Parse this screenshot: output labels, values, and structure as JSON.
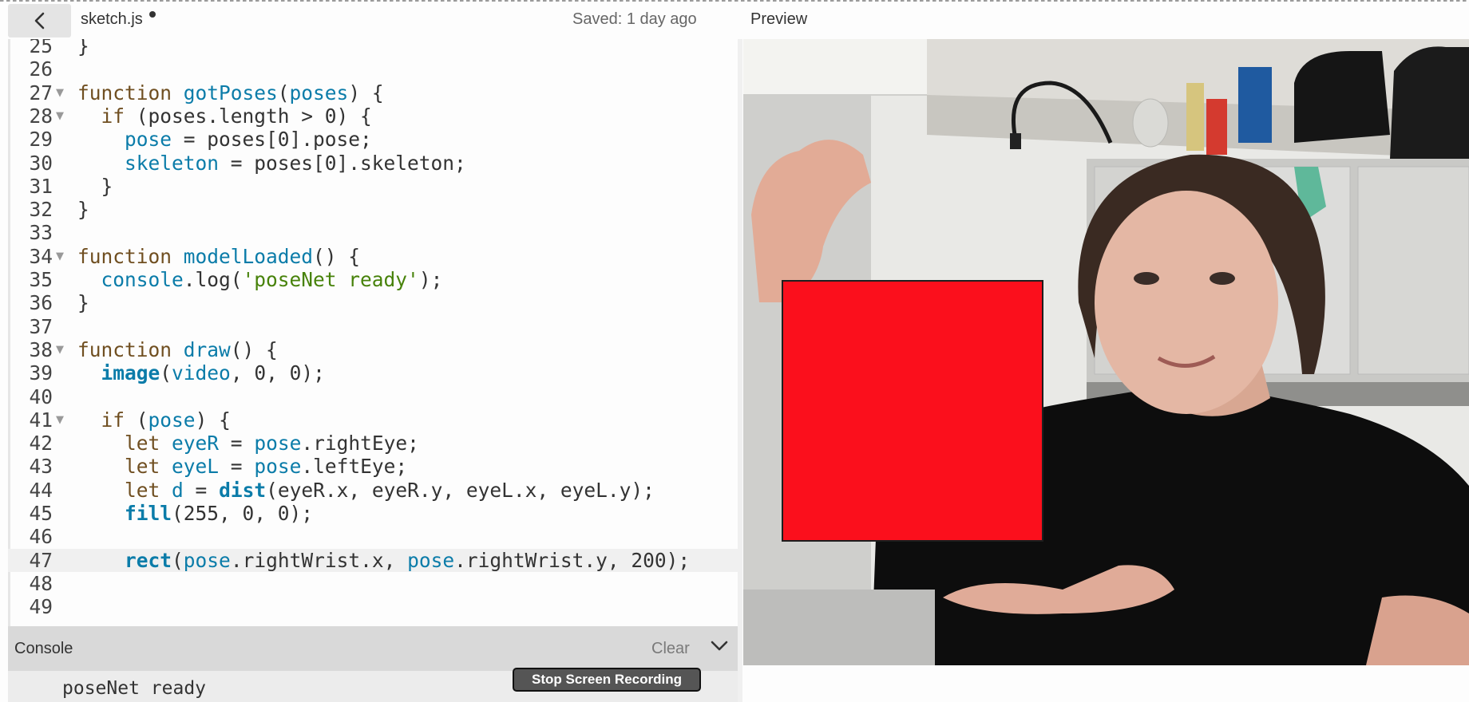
{
  "header": {
    "back_label": "",
    "file_name": "sketch.js",
    "saved_status": "Saved: 1 day ago",
    "preview_label": "Preview"
  },
  "editor": {
    "active_line": 47,
    "lines": [
      {
        "n": "25",
        "fold": false,
        "tokens": [
          [
            "p",
            "}"
          ]
        ]
      },
      {
        "n": "26",
        "fold": false,
        "tokens": []
      },
      {
        "n": "27",
        "fold": true,
        "tokens": [
          [
            "kw",
            "function "
          ],
          [
            "fn",
            "gotPoses"
          ],
          [
            "p",
            "("
          ],
          [
            "vr",
            "poses"
          ],
          [
            "p",
            ") {"
          ]
        ]
      },
      {
        "n": "28",
        "fold": true,
        "tokens": [
          [
            "p",
            "  "
          ],
          [
            "kw",
            "if"
          ],
          [
            "p",
            " (poses.length > 0) {"
          ]
        ]
      },
      {
        "n": "29",
        "fold": false,
        "tokens": [
          [
            "p",
            "    "
          ],
          [
            "vr",
            "pose"
          ],
          [
            "p",
            " = poses[0].pose;"
          ]
        ]
      },
      {
        "n": "30",
        "fold": false,
        "tokens": [
          [
            "p",
            "    "
          ],
          [
            "vr",
            "skeleton"
          ],
          [
            "p",
            " = poses[0].skeleton;"
          ]
        ]
      },
      {
        "n": "31",
        "fold": false,
        "tokens": [
          [
            "p",
            "  }"
          ]
        ]
      },
      {
        "n": "32",
        "fold": false,
        "tokens": [
          [
            "p",
            "}"
          ]
        ]
      },
      {
        "n": "33",
        "fold": false,
        "tokens": []
      },
      {
        "n": "34",
        "fold": true,
        "tokens": [
          [
            "kw",
            "function "
          ],
          [
            "fn",
            "modelLoaded"
          ],
          [
            "p",
            "() {"
          ]
        ]
      },
      {
        "n": "35",
        "fold": false,
        "tokens": [
          [
            "p",
            "  "
          ],
          [
            "vr",
            "console"
          ],
          [
            "p",
            ".log("
          ],
          [
            "str",
            "'poseNet ready'"
          ],
          [
            "p",
            ");"
          ]
        ]
      },
      {
        "n": "36",
        "fold": false,
        "tokens": [
          [
            "p",
            "}"
          ]
        ]
      },
      {
        "n": "37",
        "fold": false,
        "tokens": []
      },
      {
        "n": "38",
        "fold": true,
        "tokens": [
          [
            "kw",
            "function "
          ],
          [
            "fn",
            "draw"
          ],
          [
            "p",
            "() {"
          ]
        ]
      },
      {
        "n": "39",
        "fold": false,
        "tokens": [
          [
            "p",
            "  "
          ],
          [
            "bi",
            "image"
          ],
          [
            "p",
            "("
          ],
          [
            "vr",
            "video"
          ],
          [
            "p",
            ", 0, 0);"
          ]
        ]
      },
      {
        "n": "40",
        "fold": false,
        "tokens": []
      },
      {
        "n": "41",
        "fold": true,
        "tokens": [
          [
            "p",
            "  "
          ],
          [
            "kw",
            "if"
          ],
          [
            "p",
            " ("
          ],
          [
            "vr",
            "pose"
          ],
          [
            "p",
            ") {"
          ]
        ]
      },
      {
        "n": "42",
        "fold": false,
        "tokens": [
          [
            "p",
            "    "
          ],
          [
            "kw",
            "let "
          ],
          [
            "vr",
            "eyeR"
          ],
          [
            "p",
            " = "
          ],
          [
            "vr",
            "pose"
          ],
          [
            "p",
            ".rightEye;"
          ]
        ]
      },
      {
        "n": "43",
        "fold": false,
        "tokens": [
          [
            "p",
            "    "
          ],
          [
            "kw",
            "let "
          ],
          [
            "vr",
            "eyeL"
          ],
          [
            "p",
            " = "
          ],
          [
            "vr",
            "pose"
          ],
          [
            "p",
            ".leftEye;"
          ]
        ]
      },
      {
        "n": "44",
        "fold": false,
        "tokens": [
          [
            "p",
            "    "
          ],
          [
            "kw",
            "let "
          ],
          [
            "vr",
            "d"
          ],
          [
            "p",
            " = "
          ],
          [
            "bi",
            "dist"
          ],
          [
            "p",
            "(eyeR.x, eyeR.y, eyeL.x, eyeL.y);"
          ]
        ]
      },
      {
        "n": "45",
        "fold": false,
        "tokens": [
          [
            "p",
            "    "
          ],
          [
            "bi",
            "fill"
          ],
          [
            "p",
            "(255, 0, 0);"
          ]
        ]
      },
      {
        "n": "46",
        "fold": false,
        "tokens": []
      },
      {
        "n": "47",
        "fold": false,
        "tokens": [
          [
            "p",
            "    "
          ],
          [
            "bi",
            "rect"
          ],
          [
            "p",
            "("
          ],
          [
            "vr",
            "pose"
          ],
          [
            "p",
            ".rightWrist.x, "
          ],
          [
            "vr",
            "pose"
          ],
          [
            "p",
            ".rightWrist.y, 200);"
          ]
        ]
      },
      {
        "n": "48",
        "fold": false,
        "tokens": []
      },
      {
        "n": "49",
        "fold": false,
        "tokens": []
      }
    ]
  },
  "console": {
    "title": "Console",
    "clear_label": "Clear",
    "messages": [
      "poseNet ready"
    ]
  },
  "recording": {
    "stop_label": "Stop Screen Recording"
  },
  "colors": {
    "accent_red_rect": "#fb0f1c",
    "keyword": "#704f21",
    "identifier": "#0b7ca9",
    "string": "#47820a"
  }
}
